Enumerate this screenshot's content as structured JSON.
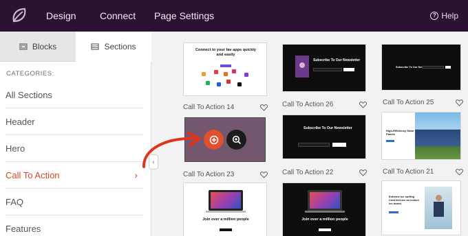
{
  "topbar": {
    "nav": [
      "Design",
      "Connect",
      "Page Settings"
    ],
    "help_label": "Help",
    "help_icon": "question-circle-icon"
  },
  "sidebar": {
    "tabs": [
      {
        "label": "Blocks",
        "icon": "blocks-icon",
        "active": false
      },
      {
        "label": "Sections",
        "icon": "sections-icon",
        "active": true
      }
    ],
    "categories_heading": "CATEGORIES:",
    "categories": [
      "All Sections",
      "Header",
      "Hero",
      "Call To Action",
      "FAQ",
      "Features"
    ],
    "active_category": "Call To Action"
  },
  "cards": {
    "cta14": {
      "label": "Call To Action 14",
      "title": "Connect to your fav apps quickly and easily"
    },
    "cta26": {
      "label": "Call To Action 26",
      "title": "Subscribe To Our Newsletter"
    },
    "cta25": {
      "label": "Call To Action 25",
      "title": "Subscribe To Our Newsletter"
    },
    "cta23": {
      "label": "Call To Action 23"
    },
    "cta22": {
      "label": "Call To Action 22",
      "title": "Subscribe To Our Newsletter"
    },
    "cta21": {
      "label": "Call To Action 21",
      "title": "High-Efficiency Solar Panels"
    },
    "row3_left": {
      "title": "Join over a million people"
    },
    "row3_mid": {
      "title": "Join over a million people"
    },
    "row3_right": {
      "title": "Extreme ice surfing Cold feet are an icebox ice board"
    }
  },
  "colors": {
    "topbar": "#2b1232",
    "accent": "#e0502c",
    "active_category": "#d24a28"
  }
}
